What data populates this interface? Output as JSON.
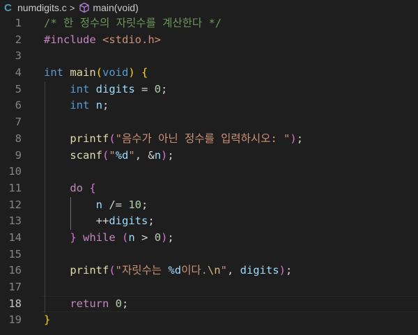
{
  "breadcrumb": {
    "file_icon_glyph": "C",
    "file_name": "numdigits.c",
    "separator": ">",
    "symbol_name": "main(void)"
  },
  "editor": {
    "active_line": 18,
    "lines": [
      {
        "num": "1",
        "segs": [
          [
            "t-comment",
            "/* 한 정수의 자릿수를 계산한다 */"
          ]
        ]
      },
      {
        "num": "2",
        "segs": [
          [
            "t-ctrl",
            "#include"
          ],
          [
            "t-op",
            " "
          ],
          [
            "t-str",
            "<stdio.h>"
          ]
        ]
      },
      {
        "num": "3",
        "segs": []
      },
      {
        "num": "4",
        "segs": [
          [
            "t-kw",
            "int"
          ],
          [
            "t-op",
            " "
          ],
          [
            "t-fn",
            "main"
          ],
          [
            "b1",
            "("
          ],
          [
            "t-kw",
            "void"
          ],
          [
            "b1",
            ")"
          ],
          [
            "t-op",
            " "
          ],
          [
            "b1",
            "{"
          ]
        ]
      },
      {
        "num": "5",
        "segs": [
          [
            "t-op",
            "    "
          ],
          [
            "t-kw",
            "int"
          ],
          [
            "t-op",
            " "
          ],
          [
            "t-var",
            "digits"
          ],
          [
            "t-op",
            " = "
          ],
          [
            "t-num",
            "0"
          ],
          [
            "t-op",
            ";"
          ]
        ]
      },
      {
        "num": "6",
        "segs": [
          [
            "t-op",
            "    "
          ],
          [
            "t-kw",
            "int"
          ],
          [
            "t-op",
            " "
          ],
          [
            "t-var",
            "n"
          ],
          [
            "t-op",
            ";"
          ]
        ]
      },
      {
        "num": "7",
        "segs": []
      },
      {
        "num": "8",
        "segs": [
          [
            "t-op",
            "    "
          ],
          [
            "t-fn",
            "printf"
          ],
          [
            "b2",
            "("
          ],
          [
            "t-str",
            "\"음수가 아닌 정수를 입력하시오: \""
          ],
          [
            "b2",
            ")"
          ],
          [
            "t-op",
            ";"
          ]
        ]
      },
      {
        "num": "9",
        "segs": [
          [
            "t-op",
            "    "
          ],
          [
            "t-fn",
            "scanf"
          ],
          [
            "b2",
            "("
          ],
          [
            "t-str",
            "\""
          ],
          [
            "t-fmt",
            "%d"
          ],
          [
            "t-str",
            "\""
          ],
          [
            "t-op",
            ", &"
          ],
          [
            "t-var",
            "n"
          ],
          [
            "b2",
            ")"
          ],
          [
            "t-op",
            ";"
          ]
        ]
      },
      {
        "num": "10",
        "segs": []
      },
      {
        "num": "11",
        "segs": [
          [
            "t-op",
            "    "
          ],
          [
            "t-ctrl",
            "do"
          ],
          [
            "t-op",
            " "
          ],
          [
            "b2",
            "{"
          ]
        ]
      },
      {
        "num": "12",
        "segs": [
          [
            "t-op",
            "        "
          ],
          [
            "t-var",
            "n"
          ],
          [
            "t-op",
            " /= "
          ],
          [
            "t-num",
            "10"
          ],
          [
            "t-op",
            ";"
          ]
        ]
      },
      {
        "num": "13",
        "segs": [
          [
            "t-op",
            "        ++"
          ],
          [
            "t-var",
            "digits"
          ],
          [
            "t-op",
            ";"
          ]
        ]
      },
      {
        "num": "14",
        "segs": [
          [
            "t-op",
            "    "
          ],
          [
            "b2",
            "}"
          ],
          [
            "t-op",
            " "
          ],
          [
            "t-ctrl",
            "while"
          ],
          [
            "t-op",
            " "
          ],
          [
            "b2",
            "("
          ],
          [
            "t-var",
            "n"
          ],
          [
            "t-op",
            " > "
          ],
          [
            "t-num",
            "0"
          ],
          [
            "b2",
            ")"
          ],
          [
            "t-op",
            ";"
          ]
        ]
      },
      {
        "num": "15",
        "segs": []
      },
      {
        "num": "16",
        "segs": [
          [
            "t-op",
            "    "
          ],
          [
            "t-fn",
            "printf"
          ],
          [
            "b2",
            "("
          ],
          [
            "t-str",
            "\"자릿수는 "
          ],
          [
            "t-fmt",
            "%d"
          ],
          [
            "t-str",
            "이다."
          ],
          [
            "t-esc",
            "\\n"
          ],
          [
            "t-str",
            "\""
          ],
          [
            "t-op",
            ", "
          ],
          [
            "t-var",
            "digits"
          ],
          [
            "b2",
            ")"
          ],
          [
            "t-op",
            ";"
          ]
        ]
      },
      {
        "num": "17",
        "segs": []
      },
      {
        "num": "18",
        "segs": [
          [
            "t-op",
            "    "
          ],
          [
            "t-ctrl",
            "return"
          ],
          [
            "t-op",
            " "
          ],
          [
            "t-num",
            "0"
          ],
          [
            "t-op",
            ";"
          ]
        ]
      },
      {
        "num": "19",
        "segs": [
          [
            "b1",
            "}"
          ]
        ]
      }
    ]
  },
  "colors": {
    "background": "#1e1e1e",
    "comment": "#6a9955",
    "keyword": "#569cd6",
    "control": "#c586c0",
    "function": "#dcdcaa",
    "variable": "#9cdcfe",
    "string": "#ce9178",
    "number": "#b5cea8",
    "bracket_level1": "#ffd700",
    "bracket_level2": "#da70d6"
  }
}
